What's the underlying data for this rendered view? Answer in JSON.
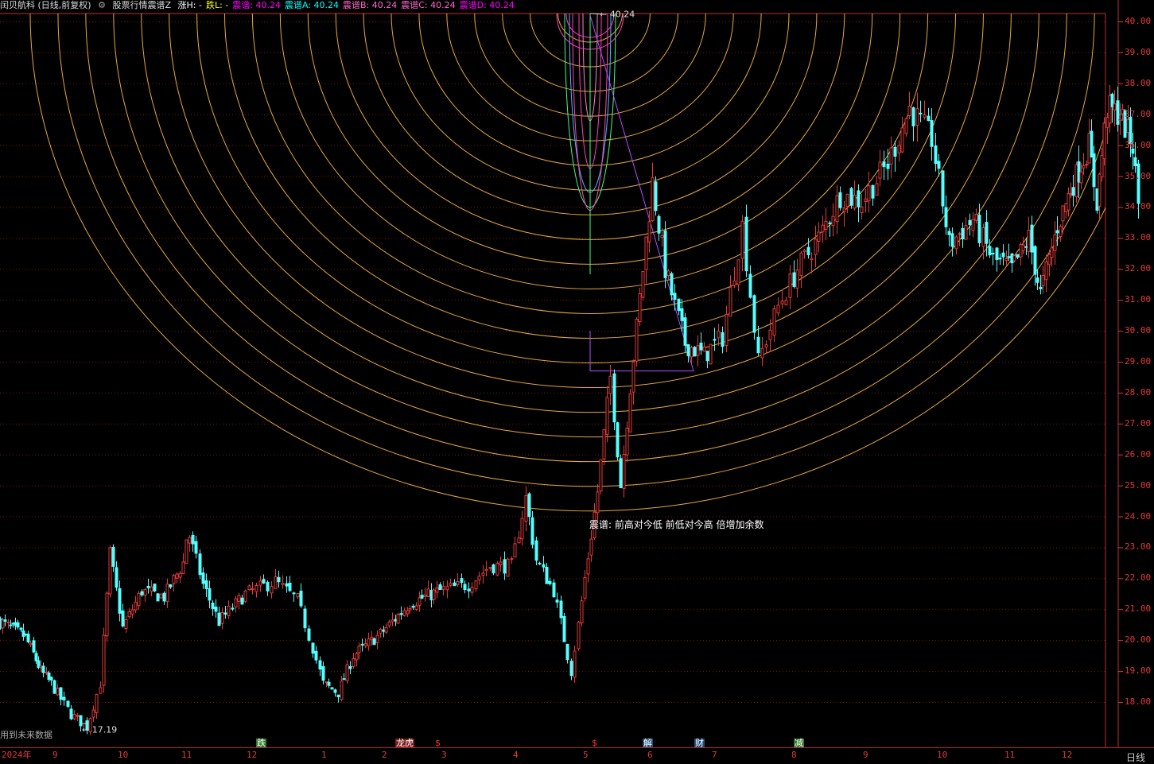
{
  "header": {
    "stock": "闰贝航科 (日线,前复权)",
    "indicator": "股票行情震谱Z",
    "items": [
      {
        "label": "涨H:",
        "value": "-",
        "color": "#ffffff"
      },
      {
        "label": "跌L:",
        "value": "-",
        "color": "#ffff00"
      },
      {
        "label": "震谱:",
        "value": "40.24",
        "color": "#ff00ff"
      },
      {
        "label": "震谱A:",
        "value": "40.24",
        "color": "#00ffff"
      },
      {
        "label": "震谱B:",
        "value": "40.24",
        "color": "#ff66cc"
      },
      {
        "label": "震谱C:",
        "value": "40.24",
        "color": "#ff66cc"
      },
      {
        "label": "震谱D:",
        "value": "40.24",
        "color": "#ff00ff"
      }
    ]
  },
  "annotations": {
    "high_label": "40.24",
    "low_label": "17.19",
    "note": "震谱: 前高对今低 前低对今高 倍增加余数",
    "future_note": "用到未来数据",
    "period": "日线"
  },
  "events": [
    {
      "label": "跌",
      "bg": "#2e7a2e",
      "color": "#ffffff",
      "month_pos": 4.15
    },
    {
      "label": "龙虎",
      "bg": "#7a1f1f",
      "color": "#ffffff",
      "month_pos": 6.25
    },
    {
      "label": "$",
      "bg": "#000000",
      "color": "#ff3333",
      "month_pos": 6.9
    },
    {
      "label": "$",
      "bg": "#000000",
      "color": "#ff3333",
      "month_pos": 9.15
    },
    {
      "label": "解",
      "bg": "#1f4f7a",
      "color": "#ffffff",
      "month_pos": 9.95
    },
    {
      "label": "财",
      "bg": "#1f4f7a",
      "color": "#ffffff",
      "month_pos": 10.75
    },
    {
      "label": "减",
      "bg": "#2e7a2e",
      "color": "#ffffff",
      "month_pos": 12.05
    }
  ],
  "chart_data": {
    "type": "candlestick",
    "title": "闰贝航科 (日线,前复权)",
    "ylim": [
      17.2,
      40.4
    ],
    "y_ticks": [
      "40.00",
      "39.00",
      "38.00",
      "37.00",
      "36.00",
      "35.00",
      "34.00",
      "33.00",
      "32.00",
      "31.00",
      "30.00",
      "29.00",
      "28.00",
      "27.00",
      "26.00",
      "25.00",
      "24.00",
      "23.00",
      "22.00",
      "21.00",
      "20.00",
      "19.00",
      "18.00"
    ],
    "x_ticks": [
      "2024年",
      "9",
      "10",
      "11",
      "12",
      "1",
      "2",
      "3",
      "4",
      "5",
      "6",
      "7",
      "8",
      "9",
      "10",
      "11",
      "12"
    ],
    "price_path": [
      [
        0,
        20.6
      ],
      [
        0.5,
        20.1
      ],
      [
        0.8,
        19.0
      ],
      [
        1.0,
        18.6
      ],
      [
        1.3,
        17.6
      ],
      [
        1.55,
        17.19
      ],
      [
        1.75,
        18.6
      ],
      [
        1.9,
        22.8
      ],
      [
        2.1,
        20.4
      ],
      [
        2.4,
        21.6
      ],
      [
        2.75,
        21.4
      ],
      [
        3.05,
        22.5
      ],
      [
        3.12,
        23.6
      ],
      [
        3.35,
        21.8
      ],
      [
        3.6,
        20.6
      ],
      [
        4.0,
        21.5
      ],
      [
        4.4,
        21.9
      ],
      [
        4.7,
        21.3
      ],
      [
        5.05,
        18.6
      ],
      [
        5.3,
        18.3
      ],
      [
        5.55,
        19.5
      ],
      [
        6.0,
        20.2
      ],
      [
        6.5,
        21.2
      ],
      [
        7.0,
        21.6
      ],
      [
        7.4,
        21.8
      ],
      [
        7.7,
        22.4
      ],
      [
        8.0,
        22.4
      ],
      [
        8.2,
        24.6
      ],
      [
        8.35,
        22.6
      ],
      [
        8.6,
        21.6
      ],
      [
        8.85,
        19.0
      ],
      [
        9.05,
        22.0
      ],
      [
        9.25,
        24.8
      ],
      [
        9.45,
        28.5
      ],
      [
        9.6,
        25.0
      ],
      [
        9.75,
        28.2
      ],
      [
        9.95,
        32.0
      ],
      [
        10.1,
        34.8
      ],
      [
        10.3,
        32.0
      ],
      [
        10.6,
        29.6
      ],
      [
        10.9,
        29.2
      ],
      [
        11.15,
        29.8
      ],
      [
        11.4,
        33.4
      ],
      [
        11.6,
        29.0
      ],
      [
        11.85,
        30.8
      ],
      [
        12.1,
        32.0
      ],
      [
        12.4,
        33.0
      ],
      [
        12.7,
        34.4
      ],
      [
        13.0,
        34.2
      ],
      [
        13.35,
        35.4
      ],
      [
        13.65,
        37.2
      ],
      [
        13.95,
        36.2
      ],
      [
        14.2,
        32.8
      ],
      [
        14.55,
        33.6
      ],
      [
        14.85,
        32.3
      ],
      [
        15.15,
        32.0
      ],
      [
        15.45,
        33.0
      ],
      [
        15.65,
        31.2
      ],
      [
        15.95,
        33.4
      ],
      [
        16.2,
        34.6
      ],
      [
        16.55,
        36.0
      ],
      [
        16.7,
        34.2
      ],
      [
        16.9,
        37.2
      ],
      [
        17.15,
        37.0
      ],
      [
        17.4,
        36.0
      ],
      [
        17.55,
        33.2
      ]
    ],
    "series": [
      {
        "name": "震谱",
        "values": [
          40.24
        ]
      },
      {
        "name": "震谱A",
        "values": [
          40.24
        ]
      },
      {
        "name": "震谱B",
        "values": [
          40.24
        ]
      },
      {
        "name": "震谱C",
        "values": [
          40.24
        ]
      },
      {
        "name": "震谱D",
        "values": [
          40.24
        ]
      }
    ],
    "high": 40.24,
    "low": 17.19,
    "grid": true
  },
  "colors": {
    "up": "#e23a3a",
    "down": "#54ffff",
    "arc": "#e6a93a",
    "grid": "#7a1a1a",
    "purple": "#b24dff",
    "magenta": "#ff40c0",
    "green": "#40ff80"
  }
}
